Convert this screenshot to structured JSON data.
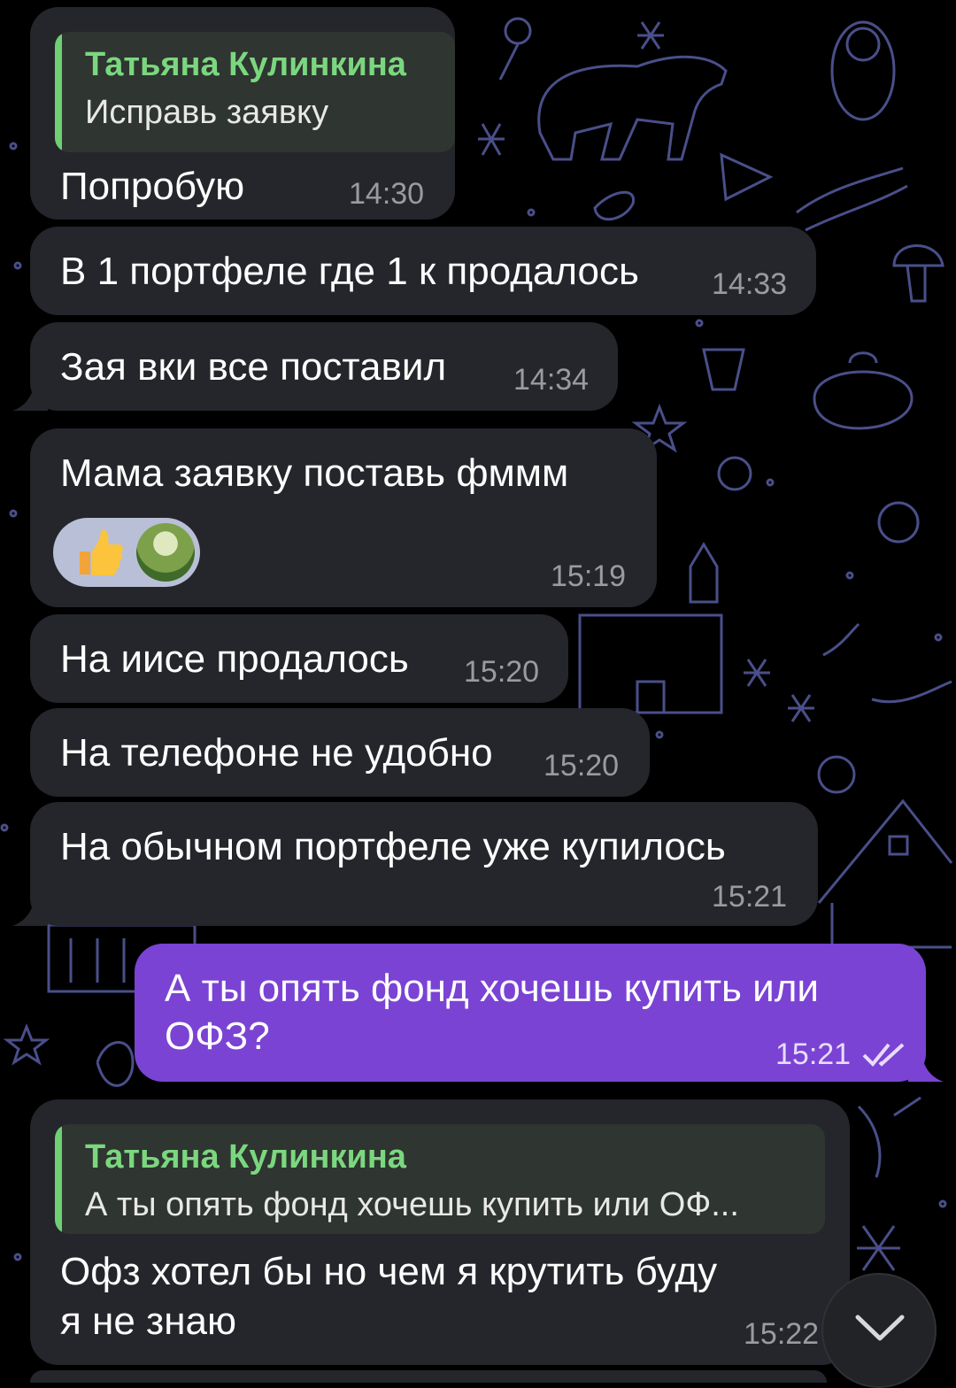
{
  "chat": {
    "messages": [
      {
        "reply_author": "Татьяна Кулинкина",
        "reply_text": "Исправь заявку",
        "text": "Попробую",
        "time": "14:30"
      },
      {
        "text": "В 1 портфеле где 1 к продалось",
        "time": "14:33"
      },
      {
        "text": "Зая вки все поставил",
        "time": "14:34"
      },
      {
        "text": "Мама заявку поставь фммм",
        "time": "15:19",
        "reactions": [
          "thumbs-up-emoji",
          "reactor-avatar"
        ]
      },
      {
        "text": "На иисе продалось",
        "time": "15:20"
      },
      {
        "text": "На телефоне не удобно",
        "time": "15:20"
      },
      {
        "text": "На обычном портфеле уже купилось",
        "time": "15:21"
      },
      {
        "outgoing": true,
        "line1": "А ты опять фонд хочешь купить или",
        "line2": "ОФЗ?",
        "time": "15:21",
        "status_icon": "double-check-icon"
      },
      {
        "reply_author": "Татьяна Кулинкина",
        "reply_text": "А ты опять фонд хочешь купить или ОФ...",
        "line1": "Офз хотел бы но чем я крутить буду",
        "line2": "я не знаю",
        "time": "15:22"
      }
    ]
  },
  "colors": {
    "incoming_bubble": "#25262b",
    "outgoing_bubble": "#7a43d4",
    "reply_accent": "#6fcf73",
    "doodle": "#4a4f8a"
  },
  "icons": {
    "scroll_down": "chevron-down-icon"
  }
}
